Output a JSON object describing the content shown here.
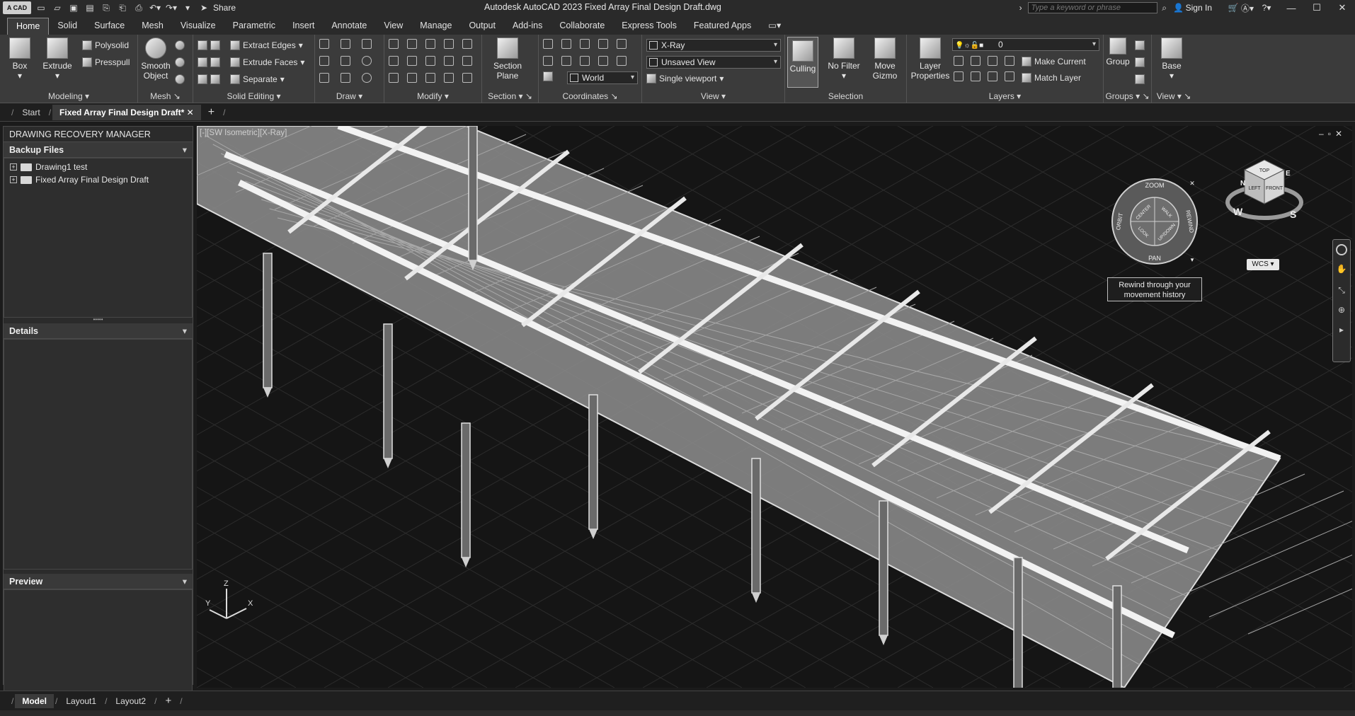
{
  "titlebar": {
    "logo": "A CAD",
    "share_label": "Share",
    "app_title": "Autodesk AutoCAD 2023    Fixed Array Final Design Draft.dwg",
    "search_placeholder": "Type a keyword or phrase",
    "signin": "Sign In",
    "qat_icons": [
      "new-icon",
      "open-icon",
      "save-icon",
      "save-as-icon",
      "open-web-icon",
      "save-web-icon",
      "plot-icon",
      "undo-icon",
      "redo-icon",
      "workspace-icon",
      "share-icon"
    ]
  },
  "ribbon_tabs": [
    "Home",
    "Solid",
    "Surface",
    "Mesh",
    "Visualize",
    "Parametric",
    "Insert",
    "Annotate",
    "View",
    "Manage",
    "Output",
    "Add-ins",
    "Collaborate",
    "Express Tools",
    "Featured Apps"
  ],
  "ribbon": {
    "modeling": {
      "title": "Modeling",
      "box": "Box",
      "extrude": "Extrude",
      "polysolid": "Polysolid",
      "presspull": "Presspull"
    },
    "mesh": {
      "title": "Mesh",
      "smooth": "Smooth",
      "object": "Object"
    },
    "solid_editing": {
      "title": "Solid Editing",
      "extract_edges": "Extract Edges",
      "extrude_faces": "Extrude Faces",
      "separate": "Separate"
    },
    "draw": {
      "title": "Draw"
    },
    "modify": {
      "title": "Modify"
    },
    "section": {
      "title": "Section",
      "plane_line1": "Section",
      "plane_line2": "Plane"
    },
    "coordinates": {
      "title": "Coordinates",
      "world": "World"
    },
    "view": {
      "title": "View",
      "visual_style": "X-Ray",
      "named_view": "Unsaved View",
      "viewport": "Single viewport"
    },
    "selection": {
      "title": "Selection",
      "culling": "Culling",
      "no_filter": "No Filter",
      "move_gizmo_1": "Move",
      "move_gizmo_2": "Gizmo"
    },
    "layers": {
      "title": "Layers",
      "layer_props_1": "Layer",
      "layer_props_2": "Properties",
      "current_layer": "0",
      "make_current": "Make Current",
      "match_layer": "Match Layer"
    },
    "groups": {
      "title": "Groups",
      "group": "Group"
    },
    "view2": {
      "title": "View",
      "base": "Base"
    }
  },
  "file_tabs": {
    "start": "Start",
    "drawing": "Fixed Array Final Design Draft*",
    "add": "+"
  },
  "palette": {
    "title": "DRAWING RECOVERY MANAGER",
    "backup_files": "Backup Files",
    "items": [
      "Drawing1 test",
      "Fixed Array Final Design Draft"
    ],
    "details": "Details",
    "preview": "Preview"
  },
  "viewport": {
    "label": "[-][SW Isometric][X-Ray]",
    "wheel": {
      "zoom": "ZOOM",
      "rewind": "REWIND",
      "pan": "PAN",
      "orbit": "ORBIT",
      "center": "CENTER",
      "walk": "WALK",
      "look": "LOOK",
      "upDown": "UP/DOWN"
    },
    "tooltip_line1": "Rewind through your",
    "tooltip_line2": "movement history",
    "cube": {
      "top": "TOP",
      "left": "LEFT",
      "front": "FRONT",
      "w": "W",
      "s": "S",
      "n": "N",
      "e": "E"
    },
    "wcs": "WCS",
    "ucs": {
      "x": "X",
      "y": "Y",
      "z": "Z"
    }
  },
  "layout_tabs": [
    "Model",
    "Layout1",
    "Layout2",
    "+"
  ],
  "colors": {
    "ribbon_bg": "#3b3b3b",
    "titlebar_bg": "#2a2a2a",
    "viewport_bg": "#151515",
    "panel_fill": "#8c8c8c"
  }
}
